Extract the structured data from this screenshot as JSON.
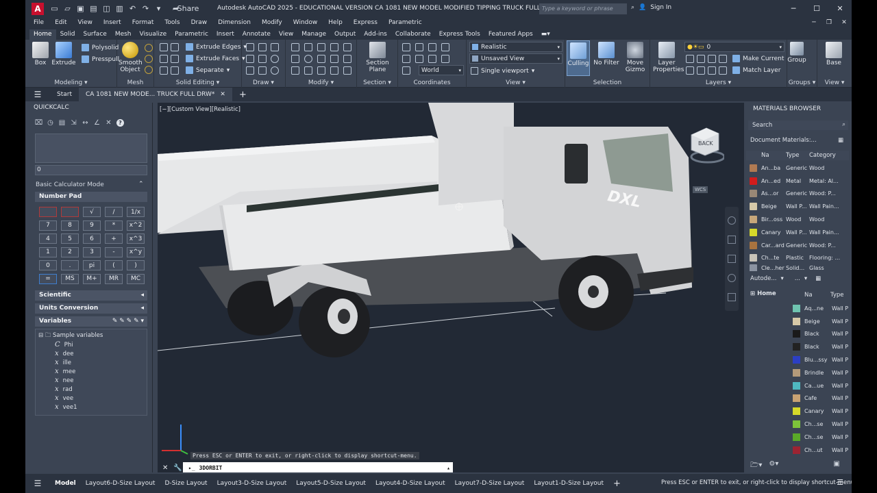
{
  "window": {
    "title": "Autodesk AutoCAD 2025 - EDUCATIONAL VERSION    CA 1081 NEW MODEL MODIFIED TIPPING TRUCK FULL DRW.dwg",
    "app_logo": "A",
    "share_label": "Share",
    "search_placeholder": "Type a keyword or phrase",
    "signin_label": "Sign In"
  },
  "menubar": [
    "File",
    "Edit",
    "View",
    "Insert",
    "Format",
    "Tools",
    "Draw",
    "Dimension",
    "Modify",
    "Window",
    "Help",
    "Express",
    "Parametric"
  ],
  "ribbon_tabs": [
    "Home",
    "Solid",
    "Surface",
    "Mesh",
    "Visualize",
    "Parametric",
    "Insert",
    "Annotate",
    "View",
    "Manage",
    "Output",
    "Add-ins",
    "Collaborate",
    "Express Tools",
    "Featured Apps"
  ],
  "ribbon": {
    "modeling": {
      "title": "Modeling",
      "box": "Box",
      "extrude": "Extrude",
      "polysolid": "Polysolid",
      "presspull": "Presspull"
    },
    "mesh": {
      "title": "Mesh",
      "smooth_object": "Smooth Object"
    },
    "solid_editing": {
      "title": "Solid Editing",
      "extrude_edges": "Extrude Edges",
      "extrude_faces": "Extrude Faces",
      "separate": "Separate"
    },
    "draw": {
      "title": "Draw"
    },
    "modify": {
      "title": "Modify"
    },
    "section": {
      "title": "Section",
      "section_plane": "Section Plane"
    },
    "coordinates": {
      "title": "Coordinates",
      "world": "World"
    },
    "view": {
      "title": "View",
      "visual_style": "Realistic",
      "named_view": "Unsaved View",
      "viewport": "Single viewport"
    },
    "selection": {
      "title": "Selection",
      "culling": "Culling",
      "no_filter": "No Filter",
      "move_gizmo": "Move Gizmo"
    },
    "layers": {
      "title": "Layers",
      "layer_properties": "Layer Properties",
      "current_layer": "0",
      "make_current": "Make Current",
      "match_layer": "Match Layer"
    },
    "groups": {
      "title": "Groups",
      "group": "Group"
    },
    "view2": {
      "title": "View",
      "base": "Base"
    }
  },
  "doc_tabs": {
    "start": "Start",
    "active": "CA 1081 NEW MODE... TRUCK FULL DRW*"
  },
  "quickcalc": {
    "title": "QUICKCALC",
    "input_value": "0",
    "mode": "Basic Calculator Mode",
    "number_pad": "Number Pad",
    "pad": [
      "",
      "",
      "√",
      "/",
      "1/x",
      "7",
      "8",
      "9",
      "*",
      "x^2",
      "4",
      "5",
      "6",
      "+",
      "x^3",
      "1",
      "2",
      "3",
      "-",
      "x^y",
      "0",
      ".",
      "pi",
      "(",
      ")",
      "=",
      "MS",
      "M+",
      "MR",
      "MC"
    ],
    "scientific": "Scientific",
    "units_conversion": "Units Conversion",
    "variables": "Variables",
    "sample_variables": "Sample variables",
    "variable_list": [
      "Phi",
      "dee",
      "ille",
      "mee",
      "nee",
      "rad",
      "vee",
      "vee1"
    ]
  },
  "viewport": {
    "label": "[−][Custom View][Realistic]",
    "viewcube_face": "BACK",
    "wcs": "WCS",
    "command_hint": "Press ESC or ENTER to exit, or right-click to display shortcut-menu.",
    "command": "3DORBIT"
  },
  "materials_browser": {
    "title": "MATERIALS BROWSER",
    "search_placeholder": "Search",
    "document_materials": "Document Materials:...",
    "columns": [
      "Na",
      "Type",
      "Category"
    ],
    "rows": [
      {
        "name": "An...ba",
        "type": "Generic",
        "category": "Wood",
        "color": "#b07a52"
      },
      {
        "name": "An...ed",
        "type": "Metal",
        "category": "Metal: Al...",
        "color": "#d21c1c"
      },
      {
        "name": "As...or",
        "type": "Generic",
        "category": "Wood: P...",
        "color": "#9a8876"
      },
      {
        "name": "Beige",
        "type": "Wall P...",
        "category": "Wall Pain...",
        "color": "#d6c9a8"
      },
      {
        "name": "Bir...oss",
        "type": "Wood",
        "category": "Wood",
        "color": "#c7a77a"
      },
      {
        "name": "Canary",
        "type": "Wall P...",
        "category": "Wall Pain...",
        "color": "#d6d92a"
      },
      {
        "name": "Car...ard",
        "type": "Generic",
        "category": "Wood: P...",
        "color": "#a8733f"
      },
      {
        "name": "Ch...te",
        "type": "Plastic",
        "category": "Flooring: ...",
        "color": "#c9c4b8"
      },
      {
        "name": "Cle...her",
        "type": "Solid...",
        "category": "Glass",
        "color": "#8b93a1"
      }
    ],
    "library": "Autode...",
    "library_more": "...",
    "tree_home": "Home",
    "lib_columns": [
      "Na",
      "Type"
    ],
    "lib_rows": [
      {
        "name": "Aq...ne",
        "type": "Wall P",
        "color": "#6fc4b0"
      },
      {
        "name": "Beige",
        "type": "Wall P",
        "color": "#d6c9a8"
      },
      {
        "name": "Black",
        "type": "Wall P",
        "color": "#1a1a1a"
      },
      {
        "name": "Black",
        "type": "Wall P",
        "color": "#222222"
      },
      {
        "name": "Blu...ssy",
        "type": "Wall P",
        "color": "#2c3fc4"
      },
      {
        "name": "Brindle",
        "type": "Wall P",
        "color": "#b39a7a"
      },
      {
        "name": "Ca...ue",
        "type": "Wall P",
        "color": "#4fb8c0"
      },
      {
        "name": "Cafe",
        "type": "Wall P",
        "color": "#c8a273"
      },
      {
        "name": "Canary",
        "type": "Wall P",
        "color": "#d6d92a"
      },
      {
        "name": "Ch...se",
        "type": "Wall P",
        "color": "#7dc43a"
      },
      {
        "name": "Ch...se",
        "type": "Wall P",
        "color": "#5aa928"
      },
      {
        "name": "Ch...ut",
        "type": "Wall P",
        "color": "#9c2432"
      }
    ]
  },
  "statusbar": {
    "layouts": [
      "Model",
      "Layout6-D-Size Layout",
      "D-Size Layout",
      "Layout3-D-Size Layout",
      "Layout5-D-Size Layout",
      "Layout4-D-Size Layout",
      "Layout7-D-Size Layout",
      "Layout1-D-Size Layout"
    ],
    "message": "Press ESC or ENTER to exit, or right-click to display shortcut-menu."
  }
}
